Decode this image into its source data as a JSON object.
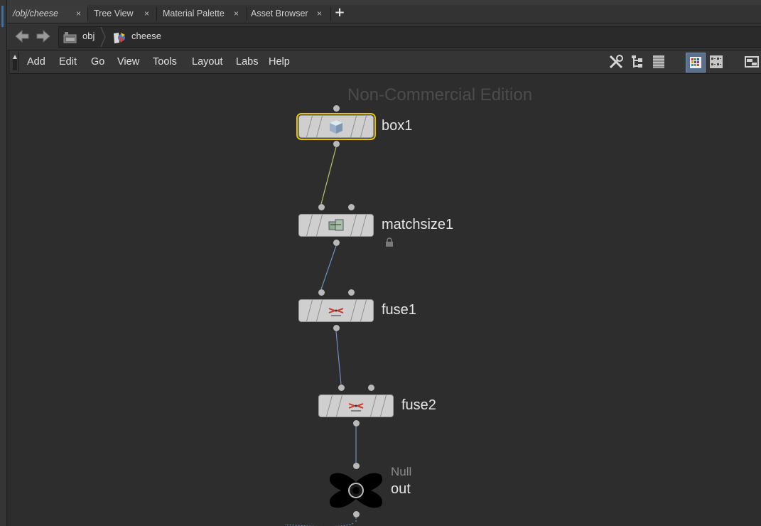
{
  "tabs": [
    {
      "label": "/obj/cheese",
      "active": true
    },
    {
      "label": "Tree View",
      "active": false
    },
    {
      "label": "Material Palette",
      "active": false
    },
    {
      "label": "Asset Browser",
      "active": false
    }
  ],
  "tab_close_glyph": "×",
  "tab_add_glyph": "+",
  "path": {
    "crumbs": [
      {
        "label": "obj",
        "icon": "obj-network-icon"
      },
      {
        "label": "cheese",
        "icon": "geo-object-icon"
      }
    ]
  },
  "menu": [
    "Add",
    "Edit",
    "Go",
    "View",
    "Tools",
    "Layout",
    "Labs",
    "Help"
  ],
  "toolbar_icons": [
    "tools-icon",
    "tree-layout-icon",
    "list-view-icon",
    "grid-view-icon",
    "detail-view-icon",
    "pane-options-icon"
  ],
  "watermark": "Non-Commercial Edition",
  "nodes": [
    {
      "name": "box1",
      "icon": "box-sop-icon",
      "selected": true
    },
    {
      "name": "matchsize1",
      "icon": "matchsize-sop-icon",
      "locked": true
    },
    {
      "name": "fuse1",
      "icon": "fuse-sop-icon"
    },
    {
      "name": "fuse2",
      "icon": "fuse-sop-icon"
    },
    {
      "name": "out",
      "type": "Null",
      "icon": "null-sop-icon"
    }
  ],
  "colors": {
    "selection_outline": "#e8c400",
    "wire_selected": "#b5c76a",
    "wire_default": "#6d8fc6",
    "canvas_bg": "#2d2d2d"
  }
}
